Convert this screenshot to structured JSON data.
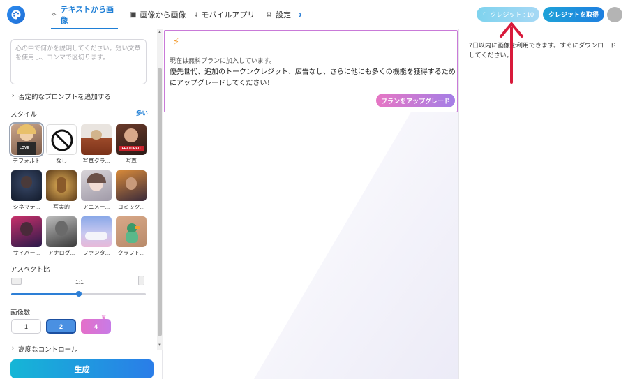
{
  "header": {
    "tabs": [
      {
        "label": "テキストから画像",
        "icon": "wand-icon"
      },
      {
        "label": "画像から画像",
        "icon": "image-icon"
      },
      {
        "label": "モバイルアプリ",
        "icon": "download-icon"
      },
      {
        "label": "設定",
        "icon": "gear-icon"
      }
    ],
    "more_icon": "chevron-right-icon",
    "credit_label": "クレジット : 10",
    "get_credit_label": "クレジットを取得"
  },
  "left": {
    "prompt_placeholder": "心の中で何かを説明してください。短い文章を使用し、コンマで区切ります。",
    "negative_prompt_label": "否定的なプロンプトを追加する",
    "style_label": "スタイル",
    "more_label": "多い",
    "styles": [
      {
        "name": "デフォルト"
      },
      {
        "name": "なし"
      },
      {
        "name": "写真クラ..."
      },
      {
        "name": "写真"
      },
      {
        "name": "シネマテ..."
      },
      {
        "name": "写実的"
      },
      {
        "name": "アニメー..."
      },
      {
        "name": "コミック..."
      },
      {
        "name": "サイバー..."
      },
      {
        "name": "アナログ..."
      },
      {
        "name": "ファンタ..."
      },
      {
        "name": "クラフト..."
      }
    ],
    "thumb_text": {
      "love": "LOVE",
      "featured": "FEATURED"
    },
    "aspect_label": "アスペクト比",
    "aspect_value": "1:1",
    "aspect_position": 0.5,
    "count_label": "画像数",
    "counts": [
      "1",
      "2",
      "4"
    ],
    "selected_count": "2",
    "advanced_label": "高度なコントロール",
    "generate_label": "生成"
  },
  "center": {
    "plan_text": "現在は無料プランに加入しています。",
    "benefit_text": "優先世代、追加のトークンクレジット、広告なし、さらに他にも多くの機能を獲得するためにアップグレードしてください！",
    "upgrade_label": "プランをアップグレード"
  },
  "right": {
    "notice": "7日以内に画像を利用できます。すぐにダウンロードしてください。"
  },
  "colors": {
    "accent": "#1f7fd6",
    "annotation_arrow": "#d81a3b"
  }
}
